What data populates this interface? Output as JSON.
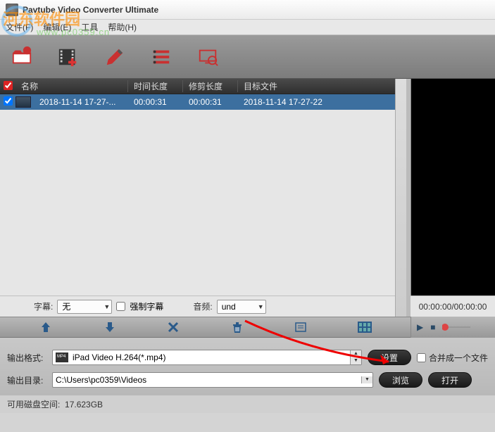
{
  "window": {
    "title": "Pavtube Video Converter Ultimate"
  },
  "watermark": {
    "text": "河东软件园",
    "url": "www.pc0359.cn"
  },
  "menu": {
    "file": "文件(F)",
    "edit": "编辑(E)",
    "tools": "工具",
    "help": "帮助(H)"
  },
  "columns": {
    "name": "名称",
    "duration": "时间长度",
    "trim": "修剪长度",
    "dest": "目标文件"
  },
  "rows": [
    {
      "name": "2018-11-14 17-27-...",
      "duration": "00:00:31",
      "trim": "00:00:31",
      "dest": "2018-11-14 17-27-22"
    }
  ],
  "subtitle": {
    "label": "字幕:",
    "value": "无",
    "force": "强制字幕"
  },
  "audio": {
    "label": "音频:",
    "value": "und"
  },
  "timecode": "00:00:00/00:00:00",
  "output_format": {
    "label": "输出格式:",
    "value": "iPad Video H.264(*.mp4)"
  },
  "output_dir": {
    "label": "输出目录:",
    "value": "C:\\Users\\pc0359\\Videos"
  },
  "buttons": {
    "settings": "设置",
    "browse": "浏览",
    "open": "打开"
  },
  "merge": "合并成一个文件",
  "disk": {
    "label": "可用磁盘空间:",
    "value": "17.623GB"
  }
}
